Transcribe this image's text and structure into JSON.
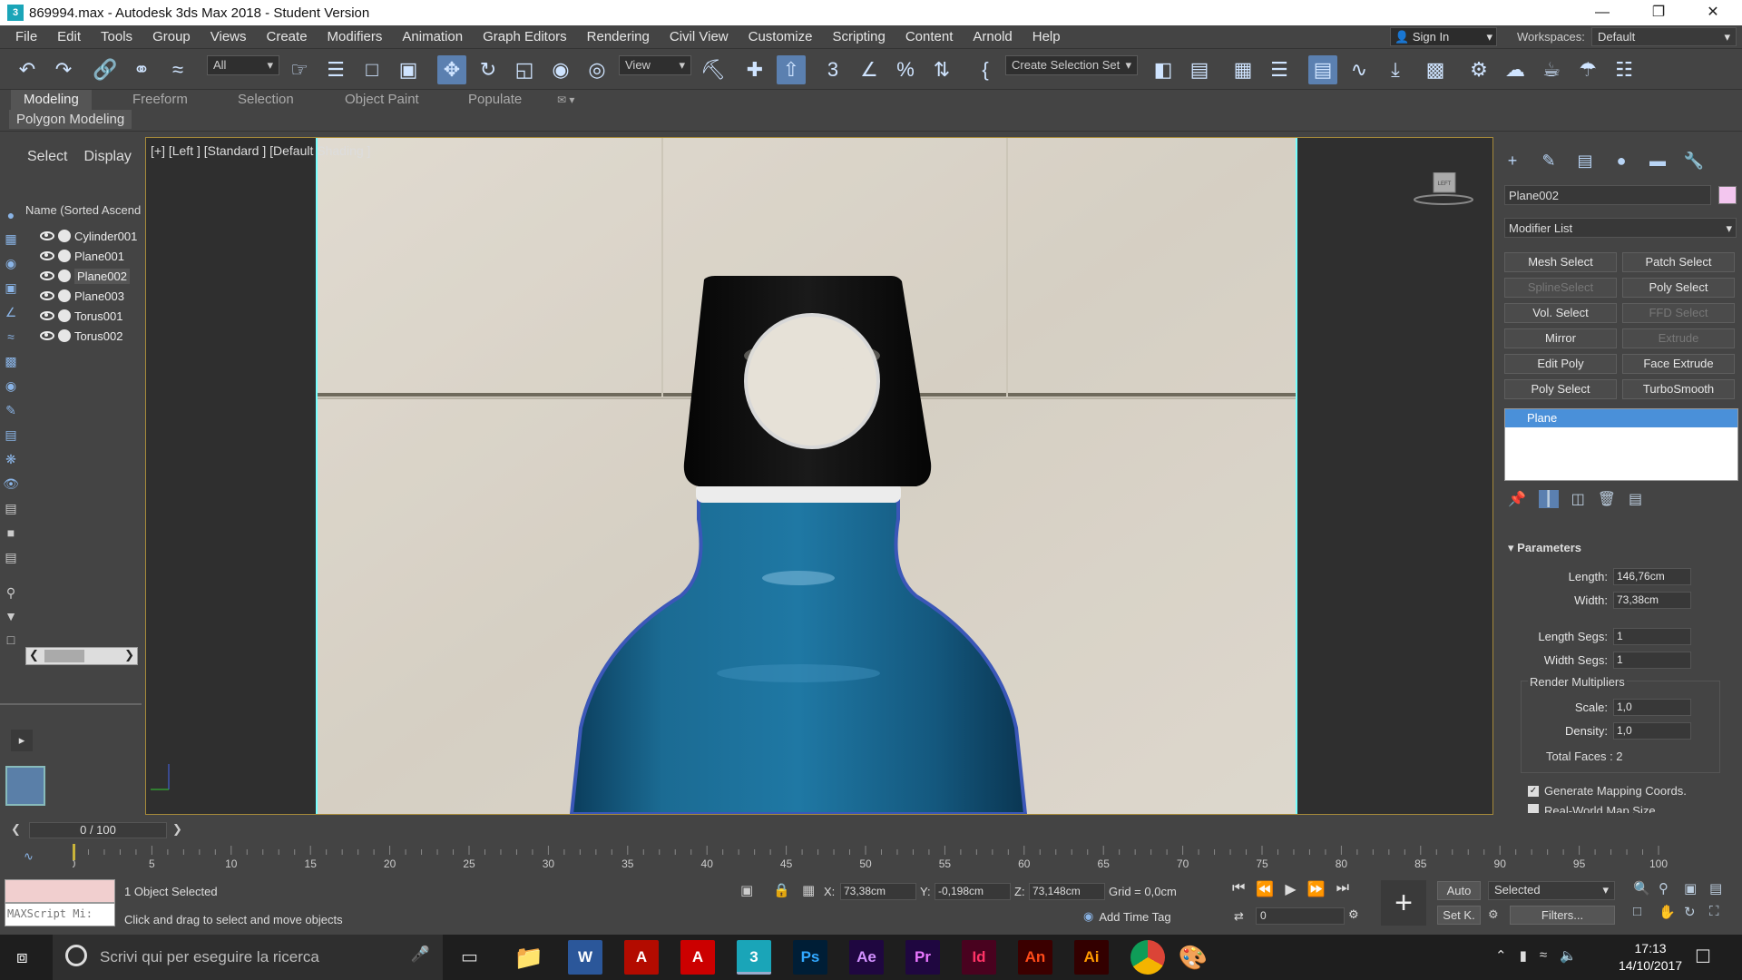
{
  "titlebar": {
    "title": "869994.max - Autodesk 3ds Max 2018 - Student Version",
    "logo": "3"
  },
  "menubar": {
    "items": [
      "File",
      "Edit",
      "Tools",
      "Group",
      "Views",
      "Create",
      "Modifiers",
      "Animation",
      "Graph Editors",
      "Rendering",
      "Civil View",
      "Customize",
      "Scripting",
      "Content",
      "Arnold",
      "Help"
    ]
  },
  "account": {
    "signin": "Sign In",
    "workspaces_label": "Workspaces:",
    "workspace": "Default"
  },
  "toolbar": {
    "filter": "All",
    "refcoord": "View",
    "selection_set": "Create Selection Set"
  },
  "ribbon": {
    "tabs": [
      "Modeling",
      "Freeform",
      "Selection",
      "Object Paint",
      "Populate"
    ],
    "sub": "Polygon Modeling"
  },
  "scene_explorer": {
    "tabs": [
      "Select",
      "Display"
    ],
    "column": "Name (Sorted Ascend",
    "items": [
      {
        "name": "Cylinder001",
        "selected": false
      },
      {
        "name": "Plane001",
        "selected": false
      },
      {
        "name": "Plane002",
        "selected": true
      },
      {
        "name": "Plane003",
        "selected": false
      },
      {
        "name": "Torus001",
        "selected": false
      },
      {
        "name": "Torus002",
        "selected": false
      }
    ]
  },
  "viewport": {
    "label": "[+] [Left ] [Standard ] [Default Shading ]",
    "viewcube": "LEFT"
  },
  "command_panel": {
    "object_name": "Plane002",
    "object_color": "#f3c6ef",
    "modifier_list": "Modifier List",
    "modifier_buttons": [
      {
        "label": "Mesh Select",
        "enabled": true
      },
      {
        "label": "Patch Select",
        "enabled": true
      },
      {
        "label": "SplineSelect",
        "enabled": false
      },
      {
        "label": "Poly Select",
        "enabled": true
      },
      {
        "label": "Vol. Select",
        "enabled": true
      },
      {
        "label": "FFD Select",
        "enabled": false
      },
      {
        "label": "Mirror",
        "enabled": true
      },
      {
        "label": "Extrude",
        "enabled": false
      },
      {
        "label": "Edit Poly",
        "enabled": true
      },
      {
        "label": "Face Extrude",
        "enabled": true
      },
      {
        "label": "Poly Select",
        "enabled": true
      },
      {
        "label": "TurboSmooth",
        "enabled": true
      }
    ],
    "stack": [
      "Plane"
    ],
    "parameters": {
      "title": "Parameters",
      "length_label": "Length:",
      "length": "146,76cm",
      "width_label": "Width:",
      "width": "73,38cm",
      "length_segs_label": "Length Segs:",
      "length_segs": "1",
      "width_segs_label": "Width Segs:",
      "width_segs": "1",
      "render_mult": "Render Multipliers",
      "scale_label": "Scale:",
      "scale": "1,0",
      "density_label": "Density:",
      "density": "1,0",
      "total_faces": "Total Faces : 2",
      "gen_mapping": "Generate Mapping Coords.",
      "real_world": "Real-World Map Size"
    }
  },
  "timeline": {
    "frame": "0 / 100",
    "ticks": [
      "0",
      "5",
      "10",
      "15",
      "20",
      "25",
      "30",
      "35",
      "40",
      "45",
      "50",
      "55",
      "60",
      "65",
      "70",
      "75",
      "80",
      "85",
      "90",
      "95",
      "100"
    ]
  },
  "status": {
    "maxscript": "MAXScript Mi:",
    "selected": "1 Object Selected",
    "prompt": "Click and drag to select and move objects",
    "x_label": "X:",
    "x": "73,38cm",
    "y_label": "Y:",
    "y": "-0,198cm",
    "z_label": "Z:",
    "z": "73,148cm",
    "grid": "Grid = 0,0cm",
    "add_time_tag": "Add Time Tag",
    "auto": "Auto",
    "set_key": "Set K.",
    "key_filter": "Selected",
    "filters": "Filters...",
    "frame_field": "0"
  },
  "taskbar": {
    "search_placeholder": "Scrivi qui per eseguire la ricerca",
    "time": "17:13",
    "date": "14/10/2017",
    "apps": [
      {
        "label": "W",
        "bg": "#2b579a",
        "fg": "#fff"
      },
      {
        "label": "A",
        "bg": "#b30b00",
        "fg": "#fff"
      },
      {
        "label": "A",
        "bg": "#c00",
        "fg": "#fff"
      },
      {
        "label": "3",
        "bg": "#1aa5b8",
        "fg": "#fff"
      },
      {
        "label": "Ps",
        "bg": "#001e36",
        "fg": "#31a8ff"
      },
      {
        "label": "Ae",
        "bg": "#1f0740",
        "fg": "#d291ff"
      },
      {
        "label": "Pr",
        "bg": "#1f0740",
        "fg": "#ea77ff"
      },
      {
        "label": "Id",
        "bg": "#49021f",
        "fg": "#ff3366"
      },
      {
        "label": "An",
        "bg": "#3b0000",
        "fg": "#ff4a19"
      },
      {
        "label": "Ai",
        "bg": "#330000",
        "fg": "#ff9a00"
      }
    ]
  }
}
